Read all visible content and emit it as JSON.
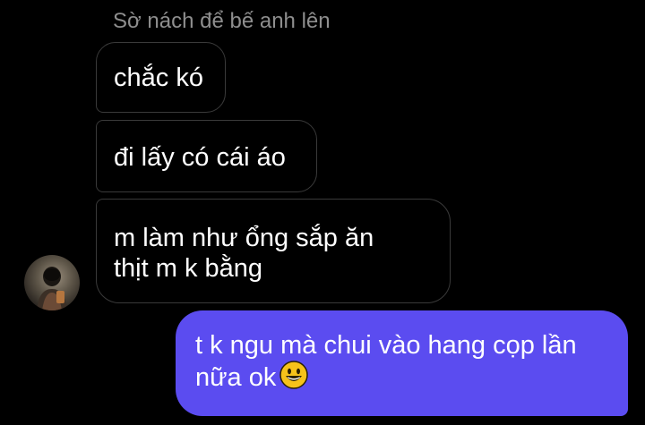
{
  "conversation": {
    "truncated_message": "Sờ nách để bế anh lên",
    "messages": [
      {
        "direction": "received",
        "lines": [
          "chắc kó"
        ]
      },
      {
        "direction": "received",
        "lines": [
          "đi lấy có cái áo"
        ]
      },
      {
        "direction": "received",
        "lines": [
          "m làm như ổng sắp ăn",
          "thịt m k bằng"
        ]
      },
      {
        "direction": "sent",
        "lines": [
          "t k ngu mà chui vào hang cọp lần",
          "nữa ok"
        ]
      }
    ],
    "emoji": "grinning-face",
    "avatar": "contact-avatar"
  },
  "colors": {
    "background": "#000000",
    "sent_bubble": "#5b4cf0",
    "received_border": "#3a3a3a",
    "muted_text": "#8e8e8e"
  }
}
